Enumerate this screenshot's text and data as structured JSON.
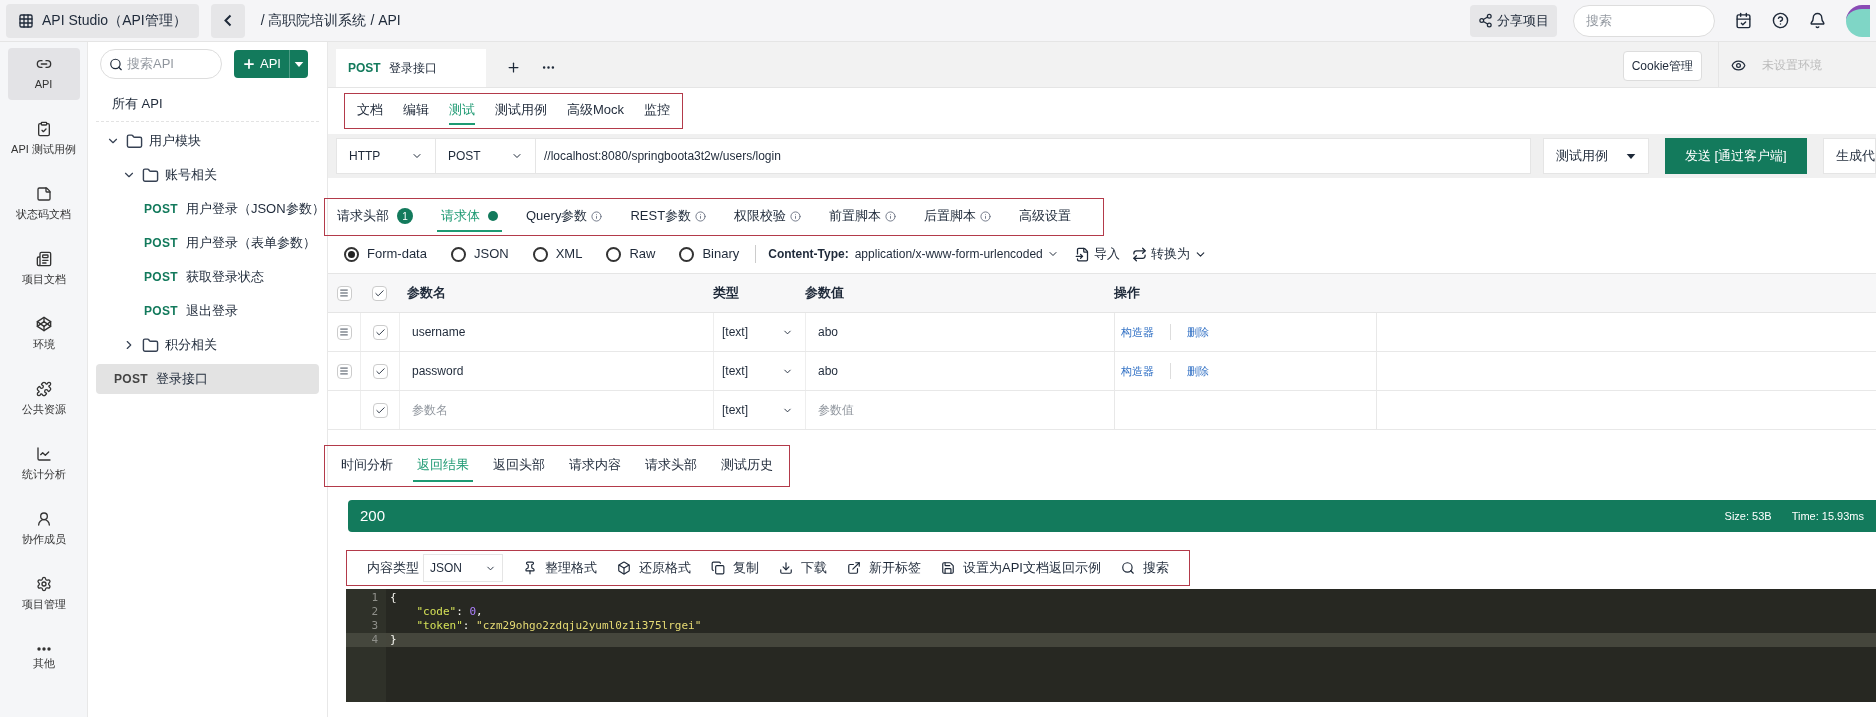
{
  "header": {
    "app_title": "API Studio（API管理）",
    "breadcrumb": "/ 高职院培训系统 / API",
    "share": "分享项目",
    "search_placeholder": "搜索"
  },
  "rail": [
    {
      "label": "API",
      "selected": true
    },
    {
      "label": "API 测试用例",
      "selected": false
    },
    {
      "label": "状态码文档",
      "selected": false
    },
    {
      "label": "项目文档",
      "selected": false
    },
    {
      "label": "环境",
      "selected": false
    },
    {
      "label": "公共资源",
      "selected": false
    },
    {
      "label": "统计分析",
      "selected": false
    },
    {
      "label": "协作成员",
      "selected": false
    },
    {
      "label": "项目管理",
      "selected": false
    },
    {
      "label": "其他",
      "selected": false
    }
  ],
  "tree": {
    "search_placeholder": "搜索API",
    "add_button": "API",
    "all_label": "所有 API",
    "nodes": [
      {
        "kind": "folder",
        "name": "用户模块",
        "expanded": true,
        "children": [
          {
            "kind": "folder",
            "name": "账号相关",
            "expanded": true,
            "children": [
              {
                "kind": "api",
                "method": "POST",
                "name": "用户登录（JSON参数）",
                "selected": false
              },
              {
                "kind": "api",
                "method": "POST",
                "name": "用户登录（表单参数）",
                "selected": false
              },
              {
                "kind": "api",
                "method": "POST",
                "name": "获取登录状态",
                "selected": false
              },
              {
                "kind": "api",
                "method": "POST",
                "name": "退出登录",
                "selected": false
              }
            ]
          },
          {
            "kind": "folder",
            "name": "积分相关",
            "expanded": false
          }
        ]
      },
      {
        "kind": "api",
        "method": "POST",
        "name": "登录接口",
        "selected": true
      }
    ]
  },
  "tabs": [
    {
      "method": "POST",
      "name": "登录接口",
      "selected": true
    }
  ],
  "cookie_button": "Cookie管理",
  "env_placeholder": "未设置环境",
  "sub_tabs": [
    {
      "label": "文档",
      "selected": false
    },
    {
      "label": "编辑",
      "selected": false
    },
    {
      "label": "测试",
      "selected": true
    },
    {
      "label": "测试用例",
      "selected": false
    },
    {
      "label": "高级Mock",
      "selected": false
    },
    {
      "label": "监控",
      "selected": false
    }
  ],
  "request": {
    "protocol": "HTTP",
    "method": "POST",
    "url": "//localhost:8080/springboota3t2w/users/login",
    "case_select": "测试用例",
    "send": "发送 [通过客户端]",
    "generate": "生成代"
  },
  "request_tabs": [
    {
      "label": "请求头部",
      "kind": "badge",
      "badge": "1",
      "selected": false
    },
    {
      "label": "请求体",
      "kind": "dot",
      "selected": true
    },
    {
      "label": "Query参数",
      "kind": "info",
      "selected": false
    },
    {
      "label": "REST参数",
      "kind": "info",
      "selected": false
    },
    {
      "label": "权限校验",
      "kind": "info",
      "selected": false
    },
    {
      "label": "前置脚本",
      "kind": "info",
      "selected": false
    },
    {
      "label": "后置脚本",
      "kind": "info",
      "selected": false
    },
    {
      "label": "高级设置",
      "kind": "plain",
      "selected": false
    }
  ],
  "body_types": [
    {
      "label": "Form-data",
      "selected": true
    },
    {
      "label": "JSON",
      "selected": false
    },
    {
      "label": "XML",
      "selected": false
    },
    {
      "label": "Raw",
      "selected": false
    },
    {
      "label": "Binary",
      "selected": false
    }
  ],
  "content_type": {
    "label": "Content-Type:",
    "value": "application/x-www-form-urlencoded"
  },
  "import": "导入",
  "convert": "转换为",
  "table": {
    "all_checked": true,
    "columns": [
      "参数名",
      "类型",
      "参数值",
      "操作"
    ],
    "rows": [
      {
        "kind": "param",
        "name": "username",
        "type": "[text]",
        "value": "abo",
        "checked": true,
        "actions": [
          "构造器",
          "删除"
        ]
      },
      {
        "kind": "param",
        "name": "password",
        "type": "[text]",
        "value": "abo",
        "checked": true,
        "actions": [
          "构造器",
          "删除"
        ]
      },
      {
        "kind": "new",
        "name_placeholder": "参数名",
        "type": "[text]",
        "value_placeholder": "参数值",
        "checked": true
      }
    ]
  },
  "response_tabs": [
    {
      "label": "时间分析",
      "selected": false
    },
    {
      "label": "返回结果",
      "selected": true
    },
    {
      "label": "返回头部",
      "selected": false
    },
    {
      "label": "请求内容",
      "selected": false
    },
    {
      "label": "请求头部",
      "selected": false
    },
    {
      "label": "测试历史",
      "selected": false
    }
  ],
  "status": {
    "code": "200",
    "stats": [
      {
        "label": "Size:",
        "value": "53B"
      },
      {
        "label": "Time:",
        "value": "15.93ms"
      }
    ]
  },
  "toolbar": {
    "content_label": "内容类型",
    "content_value": "JSON",
    "actions": [
      "整理格式",
      "还原格式",
      "复制",
      "下载",
      "新开标签",
      "设置为API文档返回示例",
      "搜索"
    ]
  },
  "code": [
    {
      "number": "1",
      "active": false,
      "segments": [
        {
          "text": "{",
          "kind": "punct"
        }
      ]
    },
    {
      "number": "2",
      "active": false,
      "segments": [
        {
          "text": "    \"code\"",
          "kind": "key"
        },
        {
          "text": ": ",
          "kind": "punct"
        },
        {
          "text": "0",
          "kind": "number"
        },
        {
          "text": ",",
          "kind": "punct"
        }
      ]
    },
    {
      "number": "3",
      "active": false,
      "segments": [
        {
          "text": "    \"token\"",
          "kind": "key"
        },
        {
          "text": ": ",
          "kind": "punct"
        },
        {
          "text": "\"czm29ohgo2zdqju2yuml0z1i375lrgei\"",
          "kind": "string"
        }
      ]
    },
    {
      "number": "4",
      "active": true,
      "segments": [
        {
          "text": "}",
          "kind": "punct"
        }
      ]
    }
  ]
}
